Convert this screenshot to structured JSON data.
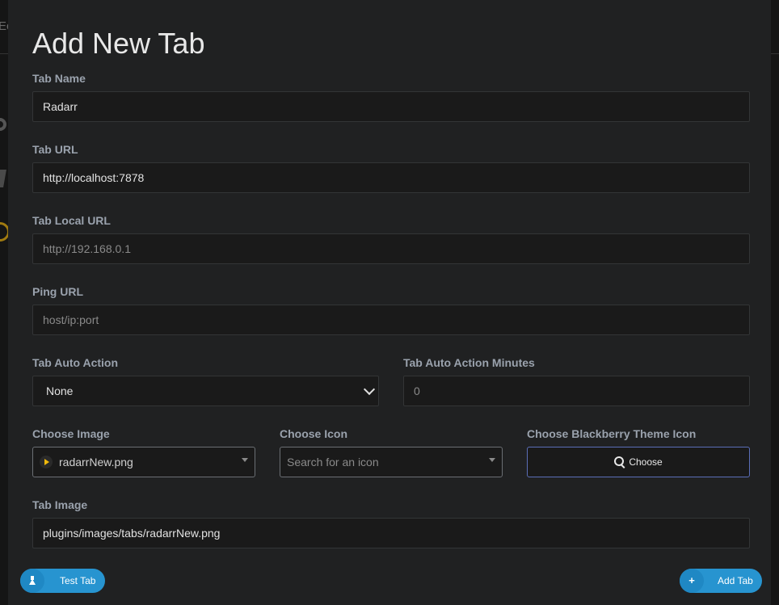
{
  "modal": {
    "title": "Add New Tab"
  },
  "background": {
    "partial_text": "Ec"
  },
  "fields": {
    "tab_name": {
      "label": "Tab Name",
      "value": "Radarr"
    },
    "tab_url": {
      "label": "Tab URL",
      "value": "http://localhost:7878"
    },
    "tab_local_url": {
      "label": "Tab Local URL",
      "placeholder": "http://192.168.0.1"
    },
    "ping_url": {
      "label": "Ping URL",
      "placeholder": "host/ip:port"
    },
    "tab_auto_action": {
      "label": "Tab Auto Action",
      "selected": "None"
    },
    "tab_auto_action_minutes": {
      "label": "Tab Auto Action Minutes",
      "placeholder": "0"
    },
    "choose_image": {
      "label": "Choose Image",
      "selected": "radarrNew.png",
      "icon": "play-icon"
    },
    "choose_icon": {
      "label": "Choose Icon",
      "placeholder": "Search for an icon"
    },
    "blackberry_icon": {
      "label": "Choose Blackberry Theme Icon",
      "button_label": "Choose",
      "icon": "search-icon"
    },
    "tab_image": {
      "label": "Tab Image",
      "value": "plugins/images/tabs/radarrNew.png"
    }
  },
  "buttons": {
    "test_tab": {
      "label": "Test Tab",
      "icon": "flask-icon"
    },
    "add_tab": {
      "label": "Add Tab",
      "icon": "plus-icon"
    }
  },
  "colors": {
    "accent": "#2794d0",
    "choose_border": "#5b6eb8",
    "image_icon": "#f0b90b"
  }
}
